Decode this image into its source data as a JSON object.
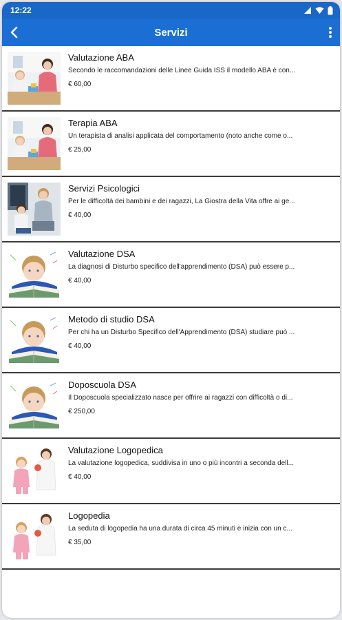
{
  "status": {
    "time": "12:22"
  },
  "appbar": {
    "title": "Servizi"
  },
  "colors": {
    "primary": "#1b6fd4",
    "statusbar": "#1967c7"
  },
  "services": [
    {
      "title": "Valutazione ABA",
      "description": "Secondo le raccomandazioni delle Linee Guida ISS il modello ABA è con...",
      "price": "€ 60,00",
      "image": "therapist-child-table"
    },
    {
      "title": "Terapia ABA",
      "description": "Un terapista di analisi applicata del comportamento (noto anche come o...",
      "price": "€ 25,00",
      "image": "therapist-child-table"
    },
    {
      "title": "Servizi Psicologici",
      "description": "Per le difficoltà dei bambini e dei ragazzi, La Giostra della Vita offre ai ge...",
      "price": "€ 40,00",
      "image": "psychologist-child"
    },
    {
      "title": "Valutazione DSA",
      "description": "La diagnosi di Disturbo specifico dell'apprendimento (DSA) può essere p...",
      "price": "€ 40,00",
      "image": "boy-with-book"
    },
    {
      "title": "Metodo di studio DSA",
      "description": "Per chi ha un Disturbo Specifico dell'Apprendimento (DSA) studiare può ...",
      "price": "€ 40,00",
      "image": "boy-with-book"
    },
    {
      "title": "Doposcuola DSA",
      "description": "Il Doposcuola specializzato nasce per offrire ai ragazzi con  difficoltà o di...",
      "price": "€ 250,00",
      "image": "boy-with-book"
    },
    {
      "title": "Valutazione Logopedica",
      "description": "La valutazione logopedica, suddivisa in uno o più incontri a seconda dell...",
      "price": "€ 40,00",
      "image": "speech-therapist-child"
    },
    {
      "title": "Logopedia",
      "description": "La seduta di logopedia ha una durata di circa 45 minuti e inizia con un c...",
      "price": "€ 35,00",
      "image": "speech-therapist-child"
    }
  ]
}
